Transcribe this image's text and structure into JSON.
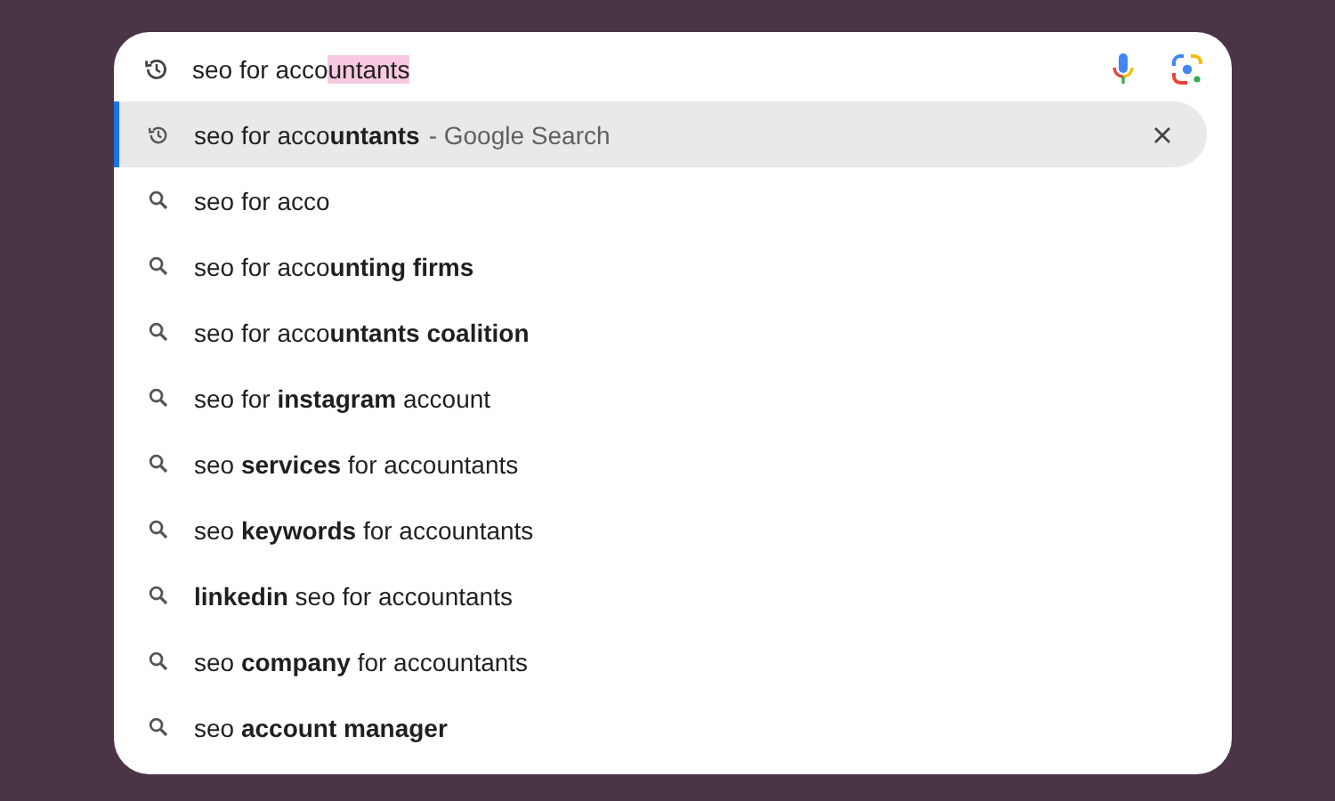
{
  "search": {
    "typed": "seo for acco",
    "completion": "untants"
  },
  "suggestions": [
    {
      "kind": "history",
      "text": "seo for acco**untants**",
      "suffix": "- Google Search",
      "selected": true
    },
    {
      "kind": "search",
      "text": "seo for acco",
      "selected": false
    },
    {
      "kind": "search",
      "text": "seo for acco**unting firms**",
      "selected": false
    },
    {
      "kind": "search",
      "text": "seo for acco**untants coalition**",
      "selected": false
    },
    {
      "kind": "search",
      "text": "seo for **instagram** account",
      "selected": false
    },
    {
      "kind": "search",
      "text": "seo **services** for accountants",
      "selected": false
    },
    {
      "kind": "search",
      "text": "seo **keywords** for accountants",
      "selected": false
    },
    {
      "kind": "search",
      "text": "**linkedin** seo for accountants",
      "selected": false
    },
    {
      "kind": "search",
      "text": "seo **company** for accountants",
      "selected": false
    },
    {
      "kind": "search",
      "text": "seo **account manager**",
      "selected": false
    }
  ]
}
